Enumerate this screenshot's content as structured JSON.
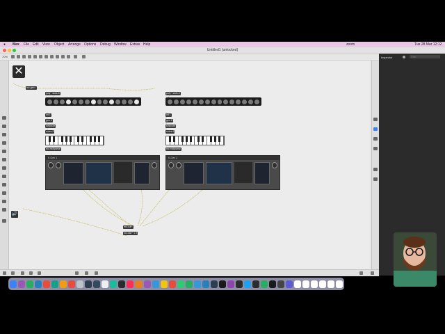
{
  "menubar": {
    "app": "Max",
    "items": [
      "File",
      "Edit",
      "View",
      "Object",
      "Arrange",
      "Options",
      "Debug",
      "Window",
      "Extras",
      "Help"
    ],
    "status_zoom": "zoom",
    "clock": "Tue 28 Mar 12:12"
  },
  "window": {
    "title": "Untitled1 (unlocked)",
    "zoom_level": "70%",
    "inspector_title": "Inspector",
    "inspector_search_placeholder": "Filter"
  },
  "patch": {
    "top_obj": "mc.gen~",
    "left": {
      "label": "poly~ slots 8",
      "dots": [
        0,
        0,
        0,
        1,
        0,
        0,
        0,
        1,
        0,
        0,
        1,
        0,
        0,
        0,
        1
      ],
      "msgs": [
        "int 1",
        "gen 8",
        "stripnote",
        "notes 8"
      ],
      "kbd_label": "mc.midiparse",
      "synth_title": "K-Gen 1"
    },
    "right": {
      "label": "poly~ slots 8",
      "dots": [
        0,
        0,
        0,
        0,
        0,
        0,
        0,
        0,
        0,
        0,
        0,
        0,
        0,
        0,
        0
      ],
      "msgs": [
        "int 1",
        "gen 8",
        "stripnote",
        "notes 8"
      ],
      "kbd_label": "mc.midiparse",
      "synth_title": "K-Gen 2"
    },
    "out_obj_1": "mc.out~",
    "out_obj_2": "mc.dac~ 1 2"
  },
  "colors": {
    "menubar": "#e9c8e6",
    "canvas": "#ececec",
    "object": "#3a3a3a",
    "cable": "#c9c06a"
  },
  "dock_icon_colors": [
    "#3b82f6",
    "#9b59b6",
    "#27ae60",
    "#2980b9",
    "#e74c3c",
    "#16a085",
    "#f39c12",
    "#e74c3c",
    "#bdc3c7",
    "#2c3e50",
    "#34495e",
    "#ecf0f1",
    "#1abc9c",
    "#2c2c2c",
    "#ff2d55",
    "#e67e22",
    "#9b59b6",
    "#3498db",
    "#f1c40f",
    "#e74c3c",
    "#2ecc71",
    "#27ae60",
    "#3498db",
    "#2980b9",
    "#2c3e50",
    "#1a1a1a",
    "#8e44ad",
    "#2c2c2c",
    "#1da1f2",
    "#2c2c2c",
    "#27ae60",
    "#1a1a1a",
    "#444",
    "#5b5bd6",
    "#fff",
    "#fff",
    "#fff",
    "#fff",
    "#fff",
    "#fff"
  ]
}
